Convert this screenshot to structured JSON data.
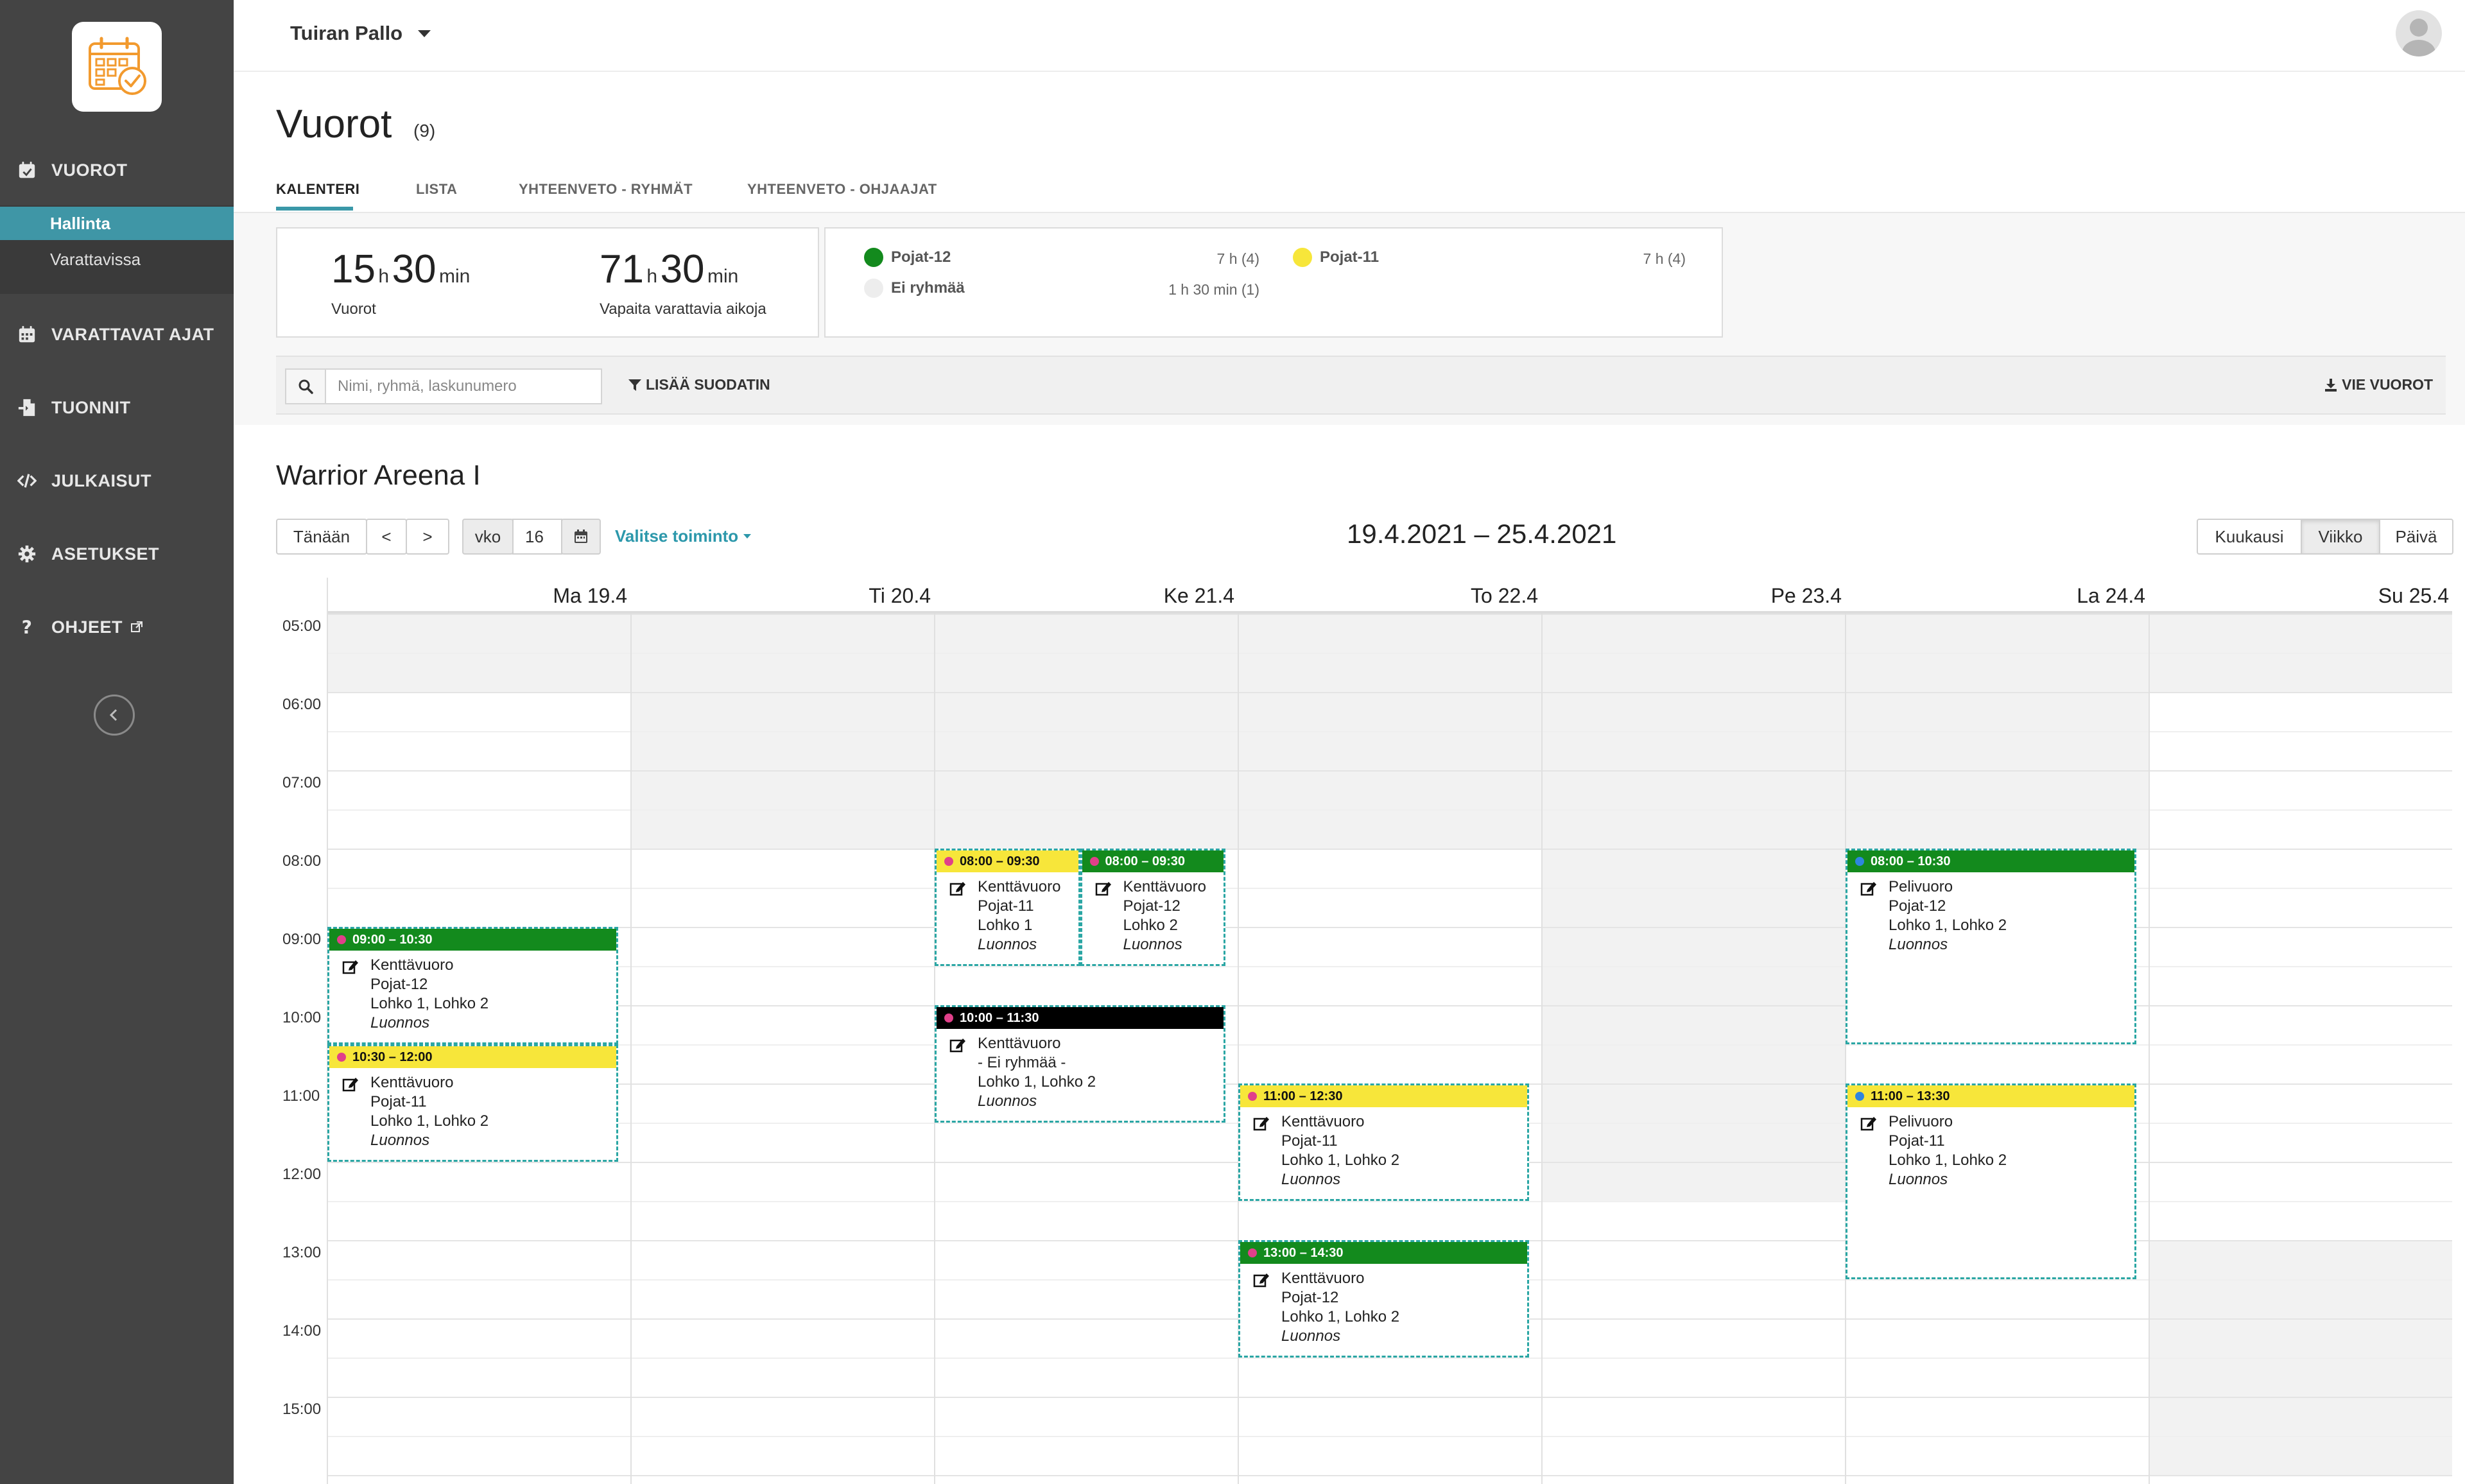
{
  "sidebar": {
    "nav": [
      {
        "id": "vuorot",
        "label": "VUOROT",
        "icon": "calendar-check-icon"
      },
      {
        "id": "varattavat",
        "label": "VARATTAVAT AJAT",
        "icon": "calendar-icon"
      },
      {
        "id": "tuonnit",
        "label": "TUONNIT",
        "icon": "file-import-icon"
      },
      {
        "id": "julkaisut",
        "label": "JULKAISUT",
        "icon": "code-icon"
      },
      {
        "id": "asetukset",
        "label": "ASETUKSET",
        "icon": "gear-icon"
      },
      {
        "id": "ohjeet",
        "label": "OHJEET",
        "icon": "question-icon"
      }
    ],
    "sub": [
      {
        "label": "Hallinta",
        "active": true
      },
      {
        "label": "Varattavissa",
        "active": false
      }
    ]
  },
  "header": {
    "org": "Tuiran Pallo"
  },
  "page": {
    "title": "Vuorot",
    "count": "(9)"
  },
  "tabs": [
    "KALENTERI",
    "LISTA",
    "YHTEENVETO - RYHMÄT",
    "YHTEENVETO - OHJAAJAT"
  ],
  "stats": {
    "total": {
      "h": "15",
      "h_unit": "h",
      "m": "30",
      "m_unit": "min",
      "label": "Vuorot"
    },
    "free": {
      "h": "71",
      "h_unit": "h",
      "m": "30",
      "m_unit": "min",
      "label": "Vapaita varattavia aikoja"
    },
    "groups": [
      {
        "name": "Pojat-12",
        "value": "7 h  (4)",
        "color": "#138a1d"
      },
      {
        "name": "Ei ryhmää",
        "value": "1 h 30 min  (1)",
        "color": "#ededed"
      },
      {
        "name": "Pojat-11",
        "value": "7 h  (4)",
        "color": "#f7e63a"
      }
    ]
  },
  "filter": {
    "placeholder": "Nimi, ryhmä, laskunumero",
    "add_filter": "LISÄÄ SUODATIN",
    "export": "VIE VUOROT"
  },
  "venue": "Warrior Areena I",
  "toolbar": {
    "today": "Tänään",
    "prev": "<",
    "next": ">",
    "week_label": "vko",
    "week": "16",
    "action": "Valitse toiminto",
    "date_range": "19.4.2021 – 25.4.2021",
    "views": [
      "Kuukausi",
      "Viikko",
      "Päivä"
    ],
    "active_view": "Viikko"
  },
  "calendar": {
    "days": [
      "Ma 19.4",
      "Ti 20.4",
      "Ke 21.4",
      "To 22.4",
      "Pe 23.4",
      "La 24.4",
      "Su 25.4"
    ],
    "times": [
      "05:00",
      "06:00",
      "07:00",
      "08:00",
      "09:00",
      "10:00",
      "11:00",
      "12:00",
      "13:00",
      "14:00",
      "15:00"
    ],
    "events": [
      {
        "day": 0,
        "start": 9.0,
        "end": 10.5,
        "col": 0,
        "cols": 1,
        "time": "09:00 – 10:30",
        "type": "Kenttävuoro",
        "group": "Pojat-12",
        "location": "Lohko 1, Lohko 2",
        "status": "Luonnos",
        "color": "#138a1d",
        "dot": "#e0408a",
        "icon": "edit-icon"
      },
      {
        "day": 0,
        "start": 10.5,
        "end": 12.0,
        "col": 0,
        "cols": 1,
        "time": "10:30 – 12:00",
        "type": "Kenttävuoro",
        "group": "Pojat-11",
        "location": "Lohko 1, Lohko 2",
        "status": "Luonnos",
        "color": "#f7e63a",
        "dot": "#e0408a",
        "icon": "edit-icon"
      },
      {
        "day": 2,
        "start": 8.0,
        "end": 9.5,
        "col": 0,
        "cols": 2,
        "time": "08:00 – 09:30",
        "type": "Kenttävuoro",
        "group": "Pojat-11",
        "location": "Lohko 1",
        "status": "Luonnos",
        "color": "#f7e63a",
        "dot": "#e0408a",
        "icon": "edit-icon"
      },
      {
        "day": 2,
        "start": 8.0,
        "end": 9.5,
        "col": 1,
        "cols": 2,
        "time": "08:00 – 09:30",
        "type": "Kenttävuoro",
        "group": "Pojat-12",
        "location": "Lohko 2",
        "status": "Luonnos",
        "color": "#138a1d",
        "dot": "#e0408a",
        "icon": "edit-icon"
      },
      {
        "day": 2,
        "start": 10.0,
        "end": 11.5,
        "col": 0,
        "cols": 1,
        "time": "10:00 – 11:30",
        "type": "Kenttävuoro",
        "group": "- Ei ryhmää -",
        "location": "Lohko 1, Lohko 2",
        "status": "Luonnos",
        "color": "#000000",
        "dot": "#e0408a",
        "icon": "edit-icon"
      },
      {
        "day": 3,
        "start": 11.0,
        "end": 12.5,
        "col": 0,
        "cols": 1,
        "time": "11:00 – 12:30",
        "type": "Kenttävuoro",
        "group": "Pojat-11",
        "location": "Lohko 1, Lohko 2",
        "status": "Luonnos",
        "color": "#f7e63a",
        "dot": "#e0408a",
        "icon": "edit-icon"
      },
      {
        "day": 3,
        "start": 13.0,
        "end": 14.5,
        "col": 0,
        "cols": 1,
        "time": "13:00 – 14:30",
        "type": "Kenttävuoro",
        "group": "Pojat-12",
        "location": "Lohko 1, Lohko 2",
        "status": "Luonnos",
        "color": "#138a1d",
        "dot": "#e0408a",
        "icon": "edit-icon"
      },
      {
        "day": 5,
        "start": 8.0,
        "end": 10.5,
        "col": 0,
        "cols": 1,
        "time": "08:00 – 10:30",
        "type": "Pelivuoro",
        "group": "Pojat-12",
        "location": "Lohko 1, Lohko 2",
        "status": "Luonnos",
        "color": "#138a1d",
        "dot": "#2e86de",
        "icon": "edit-icon"
      },
      {
        "day": 5,
        "start": 11.0,
        "end": 13.5,
        "col": 0,
        "cols": 1,
        "time": "11:00 – 13:30",
        "type": "Pelivuoro",
        "group": "Pojat-11",
        "location": "Lohko 1, Lohko 2",
        "status": "Luonnos",
        "color": "#f7e63a",
        "dot": "#2e86de",
        "icon": "edit-icon"
      }
    ]
  }
}
